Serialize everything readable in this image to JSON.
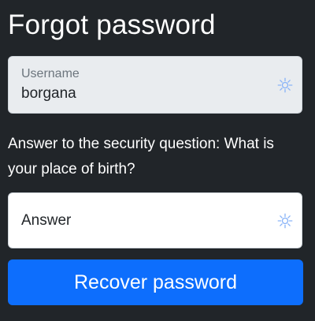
{
  "page": {
    "title": "Forgot password"
  },
  "username_field": {
    "label": "Username",
    "value": "borgana",
    "icon": "password-manager-key-icon"
  },
  "security_question": {
    "text": "Answer to the security question: What is your place of birth?"
  },
  "answer_field": {
    "placeholder": "Answer",
    "value": "",
    "icon": "password-manager-key-icon"
  },
  "actions": {
    "recover_label": "Recover password"
  },
  "colors": {
    "background": "#212529",
    "primary": "#0d6efd",
    "disabled_field": "#e9ecef",
    "icon": "#8ab4f8"
  }
}
